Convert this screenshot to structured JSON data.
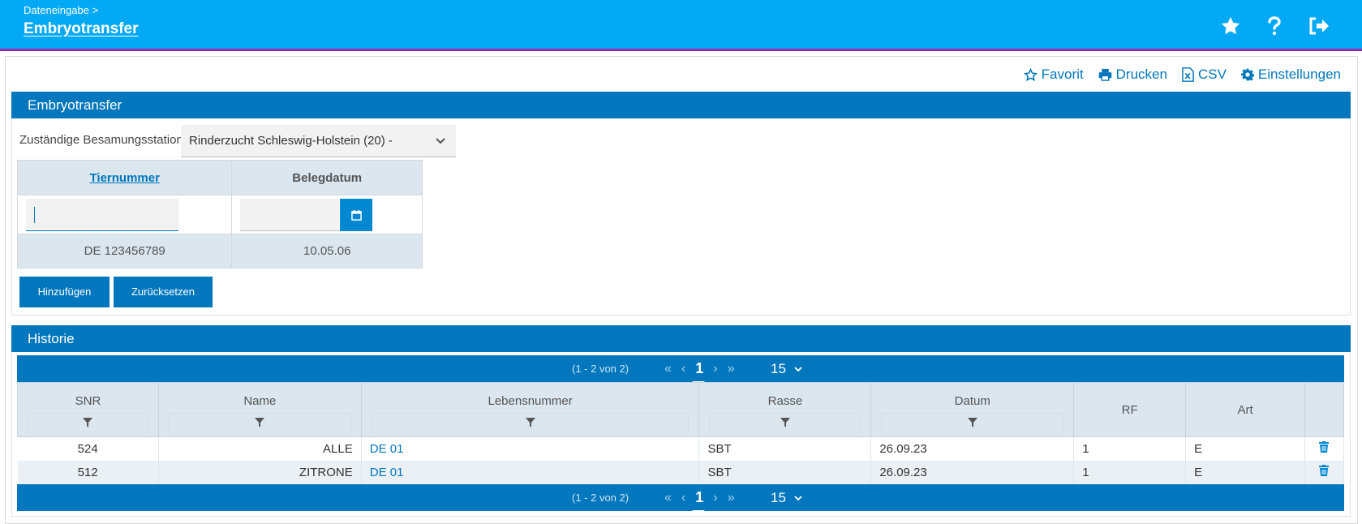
{
  "header": {
    "breadcrumb": "Dateneingabe >",
    "title": "Embryotransfer"
  },
  "actions": {
    "favorit": "Favorit",
    "drucken": "Drucken",
    "csv": "CSV",
    "einstellungen": "Einstellungen"
  },
  "entry_panel": {
    "title": "Embryotransfer",
    "station_label": "Zuständige Besamungsstation:",
    "station_value": "Rinderzucht Schleswig-Holstein (20) -",
    "col_tiernummer": "Tiernummer",
    "col_belegdatum": "Belegdatum",
    "tiernummer_input": "",
    "belegdatum_input": "",
    "row_tiernummer": "DE 123456789",
    "row_belegdatum": "10.05.06",
    "btn_add": "Hinzufügen",
    "btn_reset": "Zurücksetzen"
  },
  "history": {
    "title": "Historie",
    "pager_info": "(1 - 2 von 2)",
    "current_page": "1",
    "page_size": "15",
    "columns": [
      "SNR",
      "Name",
      "Lebensnummer",
      "Rasse",
      "Datum",
      "RF",
      "Art"
    ],
    "rows": [
      {
        "snr": "524",
        "name": "ALLE",
        "lebensnummer": "DE 01",
        "rasse": "SBT",
        "datum": "26.09.23",
        "rf": "1",
        "art": "E"
      },
      {
        "snr": "512",
        "name": "ZITRONE",
        "lebensnummer": "DE 01",
        "rasse": "SBT",
        "datum": "26.09.23",
        "rf": "1",
        "art": "E"
      }
    ]
  },
  "colors": {
    "header": "#03a9f4",
    "accent": "#0277bd",
    "header_border": "#9c27b0"
  }
}
